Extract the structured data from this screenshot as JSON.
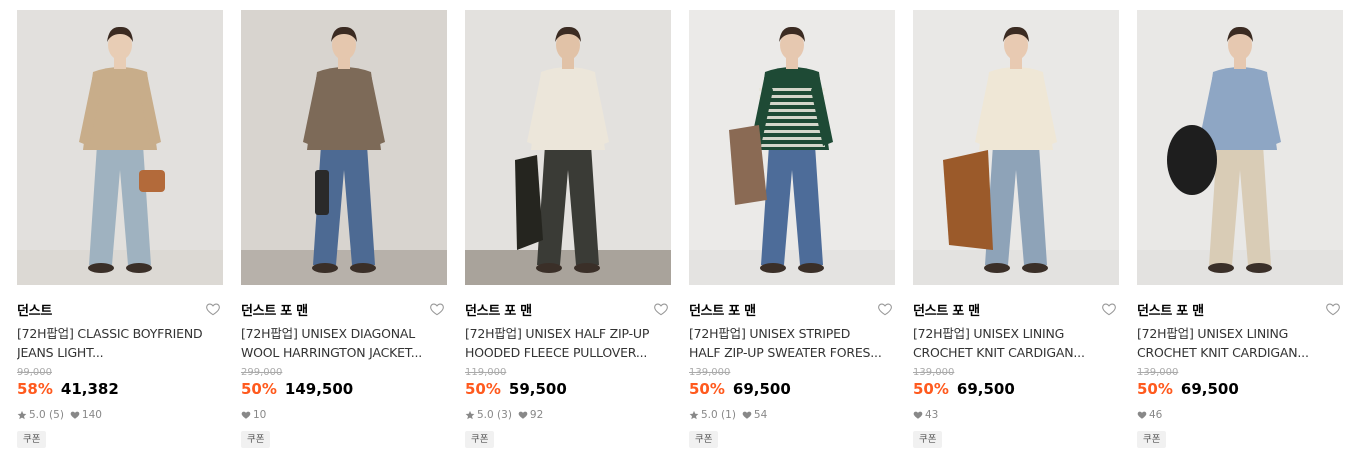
{
  "products": [
    {
      "brand": "던스트",
      "title_line1": "[72H팝업] CLASSIC BOYFRIEND",
      "title_line2": "JEANS LIGHT...",
      "original_price": "99,000",
      "discount": "58%",
      "price": "41,382",
      "rating": "5.0 (5)",
      "likes": "140",
      "coupon": "쿠폰",
      "photo": {
        "bg": "#e2e0dd",
        "floor": "#dcd9d4",
        "top": "#c8ad8a",
        "bottom": "#9fb2c0",
        "accent": "#b36a3a",
        "skin": "#e8cdb5"
      }
    },
    {
      "brand": "던스트 포 맨",
      "title_line1": "[72H팝업] UNISEX DIAGONAL",
      "title_line2": "WOOL HARRINGTON JACKET...",
      "original_price": "299,000",
      "discount": "50%",
      "price": "149,500",
      "rating": "",
      "likes": "10",
      "coupon": "쿠폰",
      "photo": {
        "bg": "#d8d4cf",
        "floor": "#b7b1aa",
        "top": "#7d6a58",
        "bottom": "#4d6a93",
        "accent": "#2a2a2a",
        "skin": "#e5c7ae"
      }
    },
    {
      "brand": "던스트 포 맨",
      "title_line1": "[72H팝업] UNISEX HALF ZIP-UP",
      "title_line2": "HOODED FLEECE PULLOVER...",
      "original_price": "119,000",
      "discount": "50%",
      "price": "59,500",
      "rating": "5.0 (3)",
      "likes": "92",
      "coupon": "쿠폰",
      "photo": {
        "bg": "#e3e1de",
        "floor": "#a9a39b",
        "top": "#ece6da",
        "bottom": "#3a3b36",
        "accent": "#25251f",
        "skin": "#e1c2a7"
      }
    },
    {
      "brand": "던스트 포 맨",
      "title_line1": "[72H팝업] UNISEX STRIPED",
      "title_line2": "HALF ZIP-UP SWEATER FORES...",
      "original_price": "139,000",
      "discount": "50%",
      "price": "69,500",
      "rating": "5.0 (1)",
      "likes": "54",
      "coupon": "쿠폰",
      "photo": {
        "bg": "#ebeae8",
        "floor": "#e4e3e1",
        "top": "#1e4a35",
        "bottom": "#4d6c99",
        "accent": "#8a6a54",
        "skin": "#e6c8b0"
      }
    },
    {
      "brand": "던스트 포 맨",
      "title_line1": "[72H팝업] UNISEX LINING",
      "title_line2": "CROCHET KNIT CARDIGAN...",
      "original_price": "139,000",
      "discount": "50%",
      "price": "69,500",
      "rating": "",
      "likes": "43",
      "coupon": "쿠폰",
      "photo": {
        "bg": "#e9e8e6",
        "floor": "#e3e2e0",
        "top": "#efe7d6",
        "bottom": "#8ea3b8",
        "accent": "#9b5a2a",
        "skin": "#e8cab2"
      }
    },
    {
      "brand": "던스트 포 맨",
      "title_line1": "[72H팝업] UNISEX LINING",
      "title_line2": "CROCHET KNIT CARDIGAN...",
      "original_price": "139,000",
      "discount": "50%",
      "price": "69,500",
      "rating": "",
      "likes": "46",
      "coupon": "쿠폰",
      "photo": {
        "bg": "#e9e8e6",
        "floor": "#e3e2e0",
        "top": "#8ea6c4",
        "bottom": "#d9ccb6",
        "accent": "#1e1e1e",
        "skin": "#e6c8b0"
      }
    }
  ],
  "icons": {
    "wishlist": "heart-outline-icon",
    "star": "star-icon",
    "like": "heart-filled-icon"
  },
  "colors": {
    "discount": "#ff5a1e",
    "coupon_bg": "#f1f1f1"
  }
}
